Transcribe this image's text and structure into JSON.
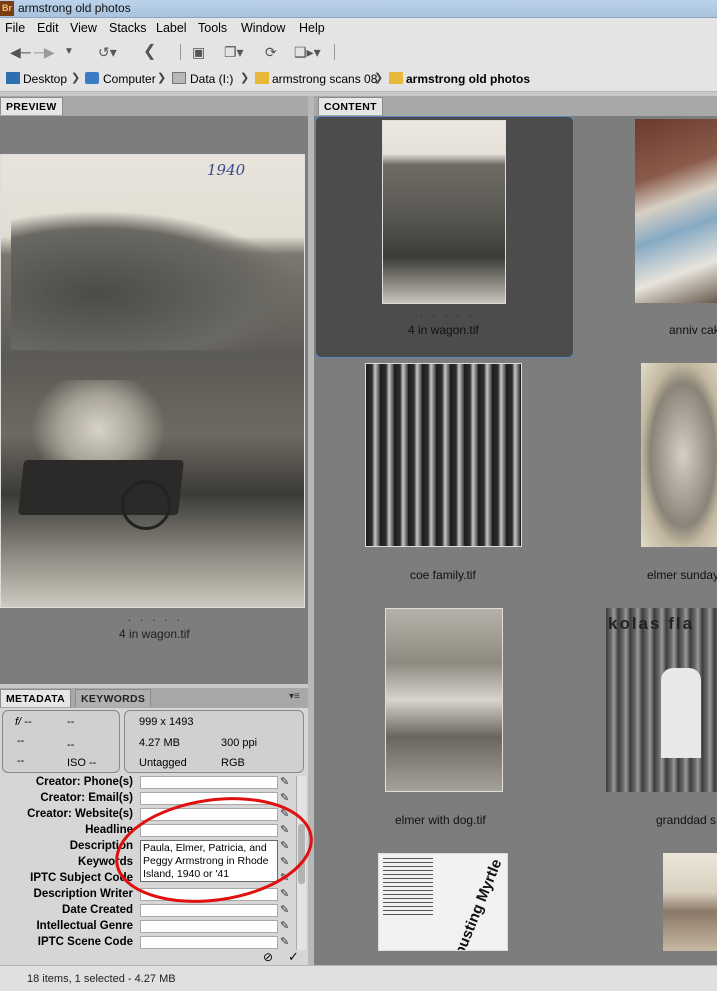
{
  "window": {
    "title": "armstrong old photos",
    "app_icon": "Br"
  },
  "menu": [
    "File",
    "Edit",
    "View",
    "Stacks",
    "Label",
    "Tools",
    "Window",
    "Help"
  ],
  "path": [
    "Desktop",
    "Computer",
    "Data (I:)",
    "armstrong scans 08",
    "armstrong old photos"
  ],
  "panels": {
    "preview_tab": "PREVIEW",
    "content_tab": "CONTENT",
    "metadata_tab": "METADATA",
    "keywords_tab": "KEYWORDS"
  },
  "preview": {
    "filename": "4 in wagon.tif",
    "rating_dots": ". . . . .",
    "photo_note": "1940"
  },
  "content": {
    "items": [
      {
        "label": "4 in wagon.tif",
        "selected": true
      },
      {
        "label": "anniv cak"
      },
      {
        "label": "coe family.tif"
      },
      {
        "label": "elmer sunday"
      },
      {
        "label": "elmer with dog.tif"
      },
      {
        "label": "granddad s"
      }
    ],
    "rating_dots": ". . . . .",
    "clipping_text": "busting Myrtle",
    "store_sign": "kolas fla"
  },
  "metadata": {
    "camera": {
      "aperture": "f/ --",
      "shutter": "--",
      "row2a": "--",
      "row2b": "--",
      "row3a": "--",
      "iso": "ISO --"
    },
    "file": {
      "dimensions": "999 x 1493",
      "size": "4.27 MB",
      "resolution": "300 ppi",
      "label": "Untagged",
      "mode": "RGB"
    },
    "fields": [
      {
        "label": "Creator: Phone(s)",
        "value": ""
      },
      {
        "label": "Creator: Email(s)",
        "value": ""
      },
      {
        "label": "Creator: Website(s)",
        "value": ""
      },
      {
        "label": "Headline",
        "value": ""
      },
      {
        "label": "Description",
        "value": "Paula, Elmer, Patricia, and Peggy Armstrong in Rhode Island, 1940 or '41"
      },
      {
        "label": "Keywords",
        "value": ""
      },
      {
        "label": "IPTC Subject Code",
        "value": ""
      },
      {
        "label": "Description Writer",
        "value": ""
      },
      {
        "label": "Date Created",
        "value": ""
      },
      {
        "label": "Intellectual Genre",
        "value": ""
      },
      {
        "label": "IPTC Scene Code",
        "value": ""
      }
    ]
  },
  "status": {
    "text": "18 items, 1 selected - 4.27 MB"
  },
  "colors": {
    "annotation": "#e01010",
    "panel_bg": "#7d7d7d",
    "selection": "#4c4c4c"
  }
}
